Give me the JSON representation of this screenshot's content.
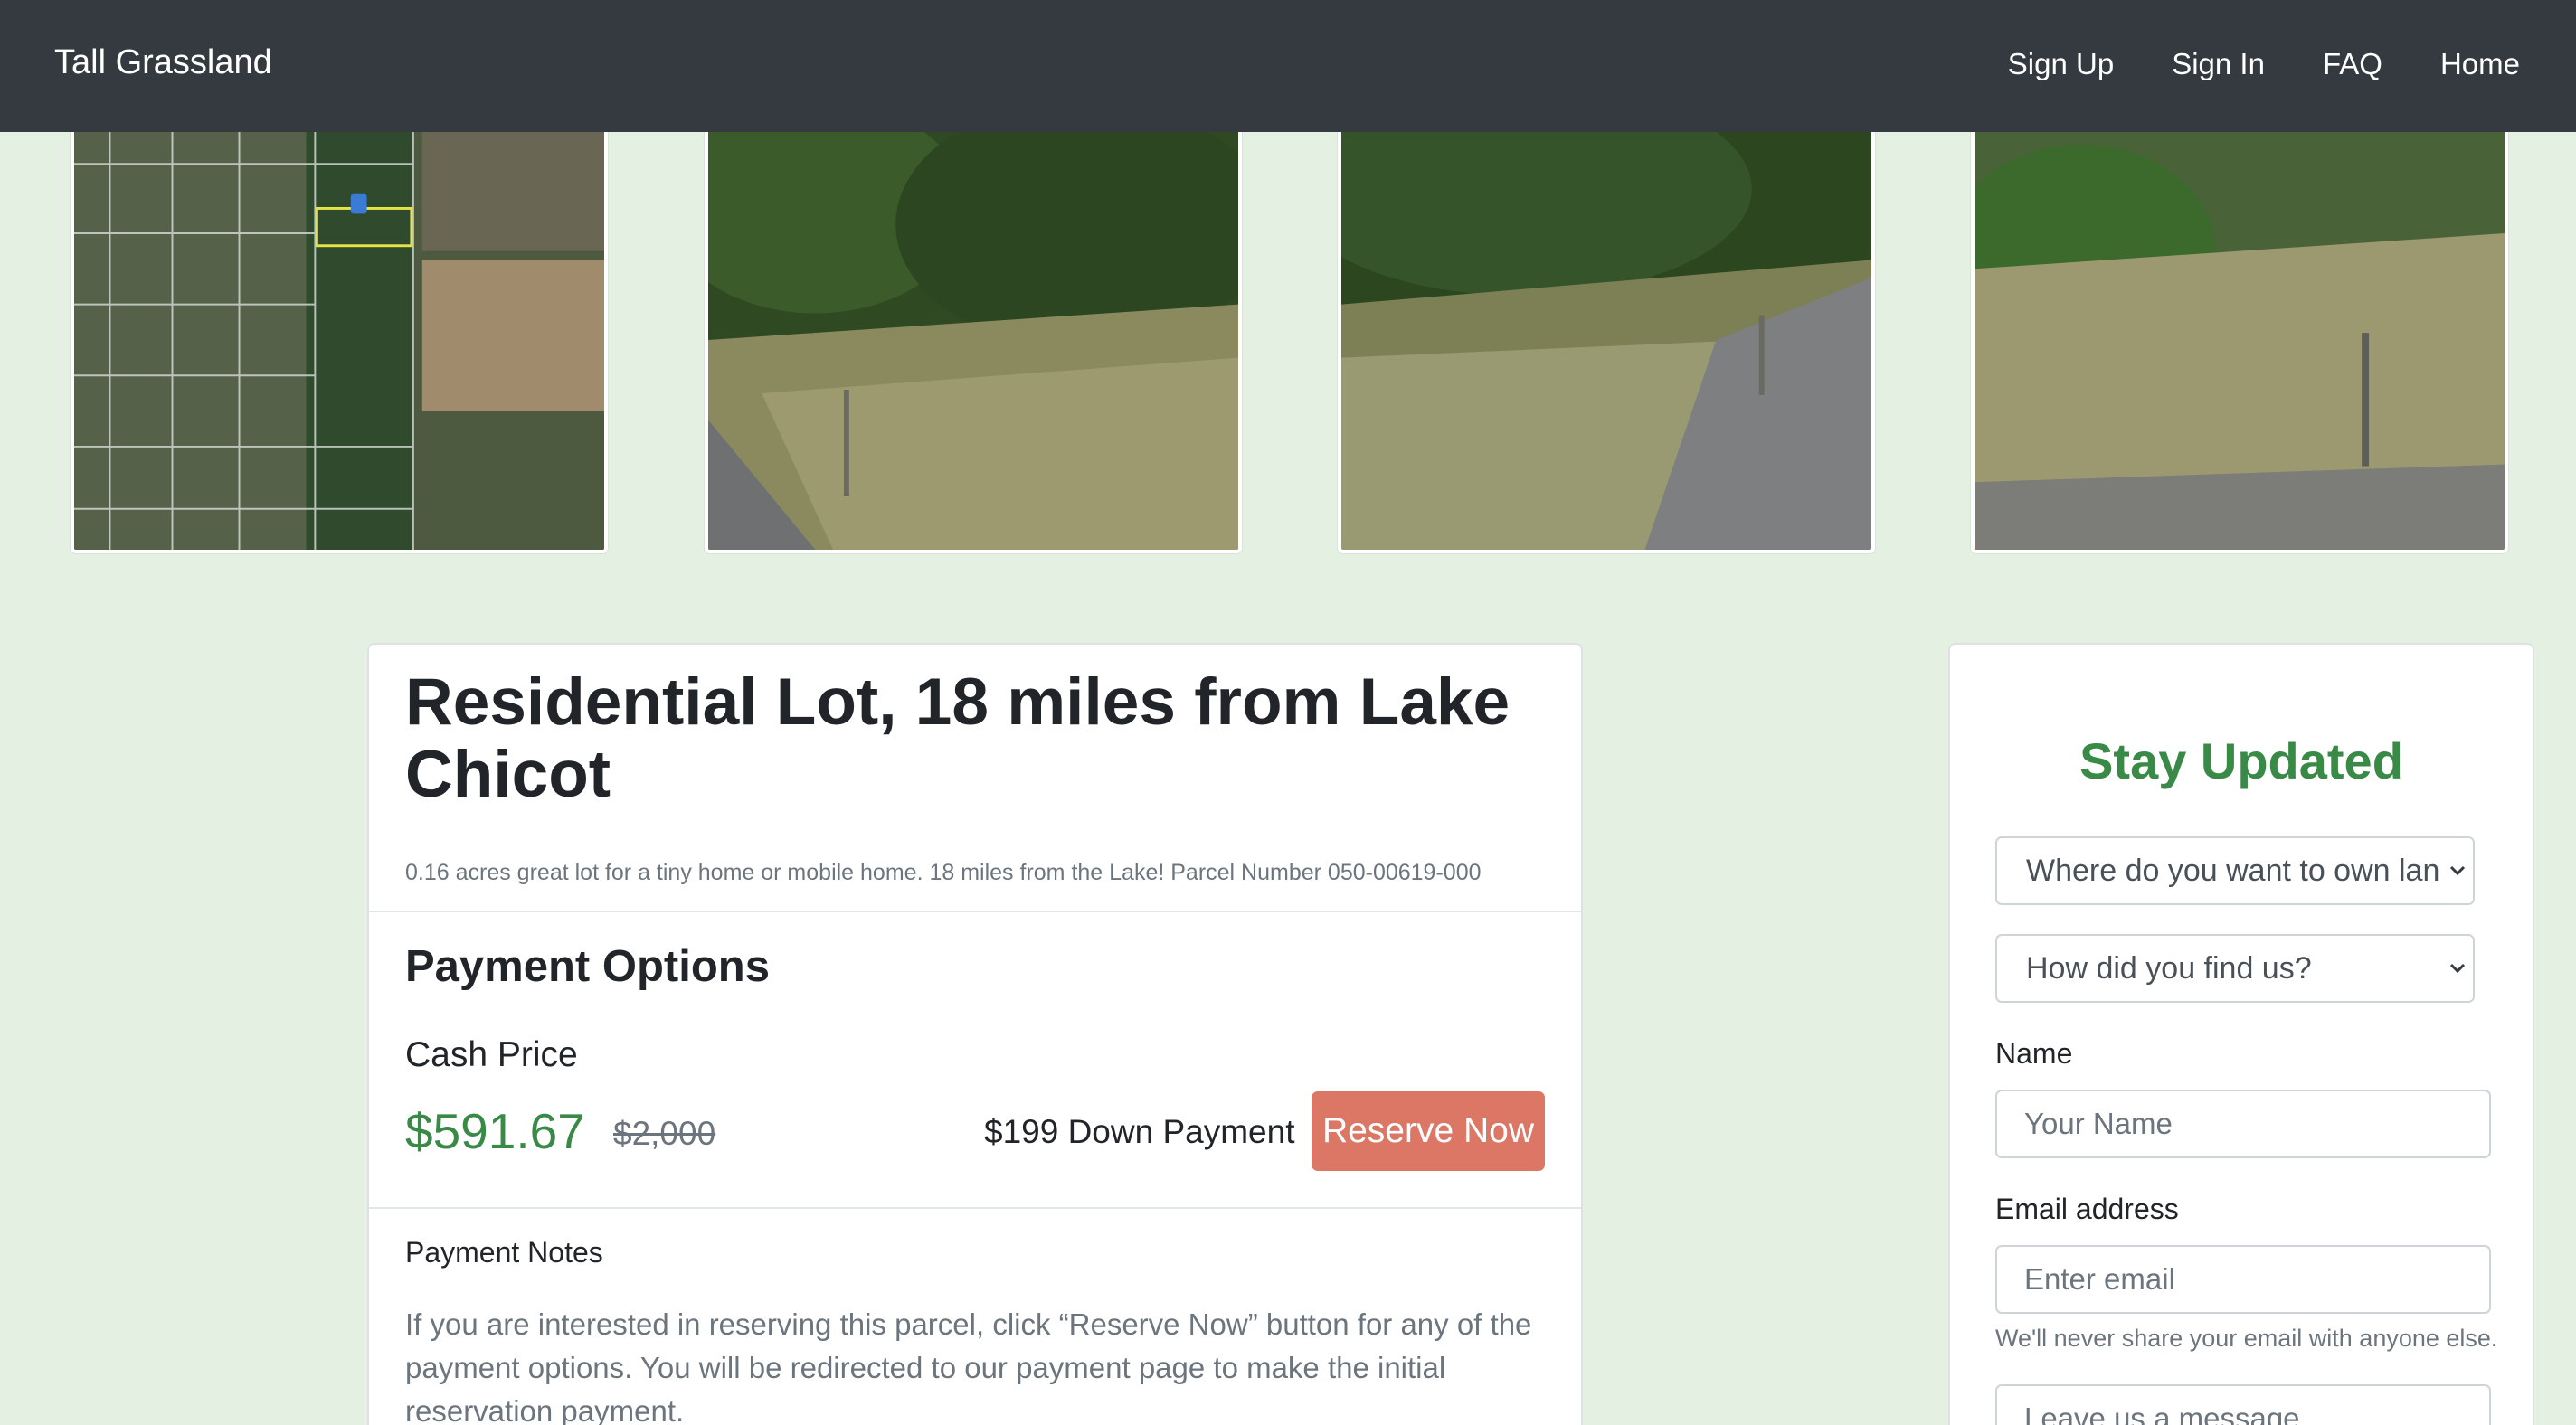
{
  "navbar": {
    "brand": "Tall Grassland",
    "links": [
      "Sign Up",
      "Sign In",
      "FAQ",
      "Home"
    ]
  },
  "photos": [
    {
      "alt": "Aerial parcel map",
      "kind": "map"
    },
    {
      "alt": "Street view of lot 1",
      "kind": "street"
    },
    {
      "alt": "Street view of lot 2",
      "kind": "street"
    },
    {
      "alt": "Street view of lot 3",
      "kind": "street"
    }
  ],
  "listing": {
    "title": "Residential Lot, 18 miles from Lake Chicot",
    "description": "0.16 acres great lot for a tiny home or mobile home. 18 miles from the Lake! Parcel Number 050-00619-000",
    "payment_heading": "Payment Options",
    "cash_label": "Cash Price",
    "cash_price": "$591.67",
    "original_price": "$2,000",
    "down_payment": "$199 Down Payment",
    "reserve_label": "Reserve Now",
    "notes_label": "Payment Notes",
    "notes_text": "If you are interested in reserving this parcel, click “Reserve Now” button for any of the payment options. You will be redirected to our payment page to make the initial reservation payment."
  },
  "stay_updated": {
    "title": "Stay Updated",
    "select_location": "Where do you want to own lan",
    "select_source": "How did you find us?",
    "name_label": "Name",
    "name_placeholder": "Your Name",
    "email_label": "Email address",
    "email_placeholder": "Enter email",
    "email_help": "We'll never share your email with anyone else.",
    "message_placeholder": "Leave us a message"
  },
  "colors": {
    "navbar_bg": "#343a40",
    "page_bg": "#e4f1e2",
    "accent_green": "#3a8a47",
    "reserve_button": "#dc7766"
  }
}
